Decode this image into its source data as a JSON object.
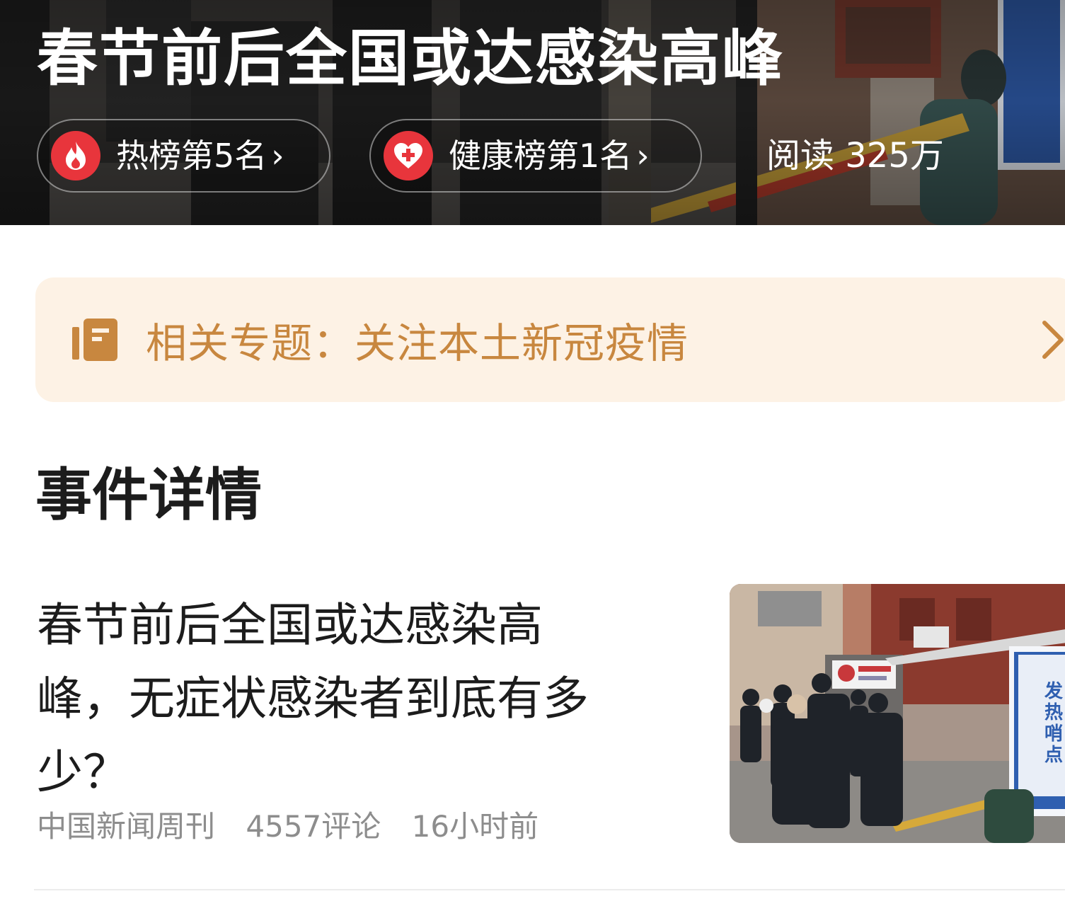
{
  "hero": {
    "title": "春节前后全国或达感染高峰",
    "hot_rank_label": "热榜第5名",
    "health_rank_label": "健康榜第1名",
    "chevron": "›",
    "read_count": "阅读 325万",
    "icons": {
      "hot": "flame-icon",
      "health": "heart-plus-icon"
    }
  },
  "topic": {
    "label": "相关专题：关注本土新冠疫情",
    "icon": "book-icon",
    "chevron_icon": "chevron-right-icon"
  },
  "section": {
    "title": "事件详情"
  },
  "article": {
    "title": "春节前后全国或达感染高峰，无症状感染者到底有多少？",
    "source": "中国新闻周刊",
    "comments": "4557评论",
    "time": "16小时前",
    "thumbnail_sign_text": "发热哨点诊室"
  },
  "colors": {
    "accent_red": "#e8353c",
    "topic_bg": "#fdf2e5",
    "topic_text": "#c8873f",
    "meta_text": "#8d8d8d",
    "title_text": "#1c1c1c"
  }
}
